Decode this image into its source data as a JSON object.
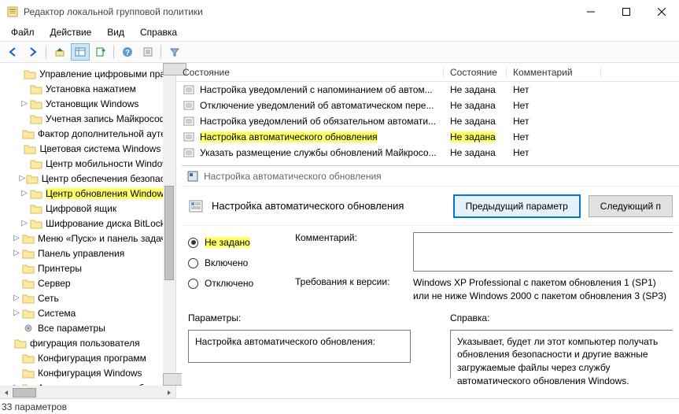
{
  "window": {
    "title": "Редактор локальной групповой политики"
  },
  "menubar": [
    "Файл",
    "Действие",
    "Вид",
    "Справка"
  ],
  "tree": {
    "items": [
      {
        "label": "Управление цифровыми права",
        "indent": 1,
        "tw": ""
      },
      {
        "label": "Установка нажатием",
        "indent": 1,
        "tw": ""
      },
      {
        "label": "Установщик Windows",
        "indent": 1,
        "tw": "▷"
      },
      {
        "label": "Учетная запись Майкрософт",
        "indent": 1,
        "tw": ""
      },
      {
        "label": "Фактор дополнительной аутент",
        "indent": 1,
        "tw": ""
      },
      {
        "label": "Цветовая система Windows Co",
        "indent": 1,
        "tw": ""
      },
      {
        "label": "Центр мобильности Windows",
        "indent": 1,
        "tw": ""
      },
      {
        "label": "Центр обеспечения безопасно",
        "indent": 1,
        "tw": "▷"
      },
      {
        "label": "Центр обновления Windows",
        "indent": 1,
        "tw": "▷",
        "highlight": true
      },
      {
        "label": "Цифровой ящик",
        "indent": 1,
        "tw": ""
      },
      {
        "label": "Шифрование диска BitLocker",
        "indent": 1,
        "tw": "▷"
      },
      {
        "label": "Меню «Пуск» и панель задач",
        "indent": 0,
        "tw": "▷"
      },
      {
        "label": "Панель управления",
        "indent": 0,
        "tw": "▷"
      },
      {
        "label": "Принтеры",
        "indent": 0,
        "tw": ""
      },
      {
        "label": "Сервер",
        "indent": 0,
        "tw": ""
      },
      {
        "label": "Сеть",
        "indent": 0,
        "tw": "▷"
      },
      {
        "label": "Система",
        "indent": 0,
        "tw": "▷"
      },
      {
        "label": "Все параметры",
        "indent": 0,
        "tw": "",
        "icon": "gear"
      },
      {
        "label": "фигурация пользователя",
        "indent": -1,
        "tw": ""
      },
      {
        "label": "Конфигурация программ",
        "indent": 0,
        "tw": ""
      },
      {
        "label": "Конфигурация Windows",
        "indent": 0,
        "tw": ""
      },
      {
        "label": "Административные шаблоны",
        "indent": 0,
        "tw": "▷"
      }
    ]
  },
  "list": {
    "columns": {
      "name": "Состояние",
      "state": "Состояние",
      "comment": "Комментарий"
    },
    "rows": [
      {
        "name": "Настройка уведомлений с напоминанием об автом...",
        "state": "Не задана",
        "comment": "Нет",
        "sel": false
      },
      {
        "name": "Отключение уведомлений об автоматическом пере...",
        "state": "Не задана",
        "comment": "Нет",
        "sel": false
      },
      {
        "name": "Настройка уведомлений об обязательном автомати...",
        "state": "Не задана",
        "comment": "Нет",
        "sel": false
      },
      {
        "name": "Настройка автоматического обновления",
        "state": "Не задана",
        "comment": "Нет",
        "sel": true
      },
      {
        "name": "Указать размещение службы обновлений Майкросо...",
        "state": "Не задана",
        "comment": "Нет",
        "sel": false
      }
    ]
  },
  "dialog": {
    "window_title": "Настройка автоматического обновления",
    "header_title": "Настройка автоматического обновления",
    "prev_btn": "Предыдущий параметр",
    "next_btn": "Следующий п",
    "radios": {
      "not_set": "Не задано",
      "enabled": "Включено",
      "disabled": "Отключено"
    },
    "comment_label": "Комментарий:",
    "requirements_label": "Требования к версии:",
    "requirements_text": "Windows XP Professional с пакетом обновления 1 (SP1) или не ниже Windows 2000 с пакетом обновления 3 (SP3)",
    "params_label": "Параметры:",
    "help_label": "Справка:",
    "params_text": "Настройка автоматического обновления:",
    "help_text": "Указывает, будет ли этот компьютер получать обновления безопасности и другие важные загружаемые файлы через службу автоматического обновления Windows."
  },
  "status": "33 параметров"
}
